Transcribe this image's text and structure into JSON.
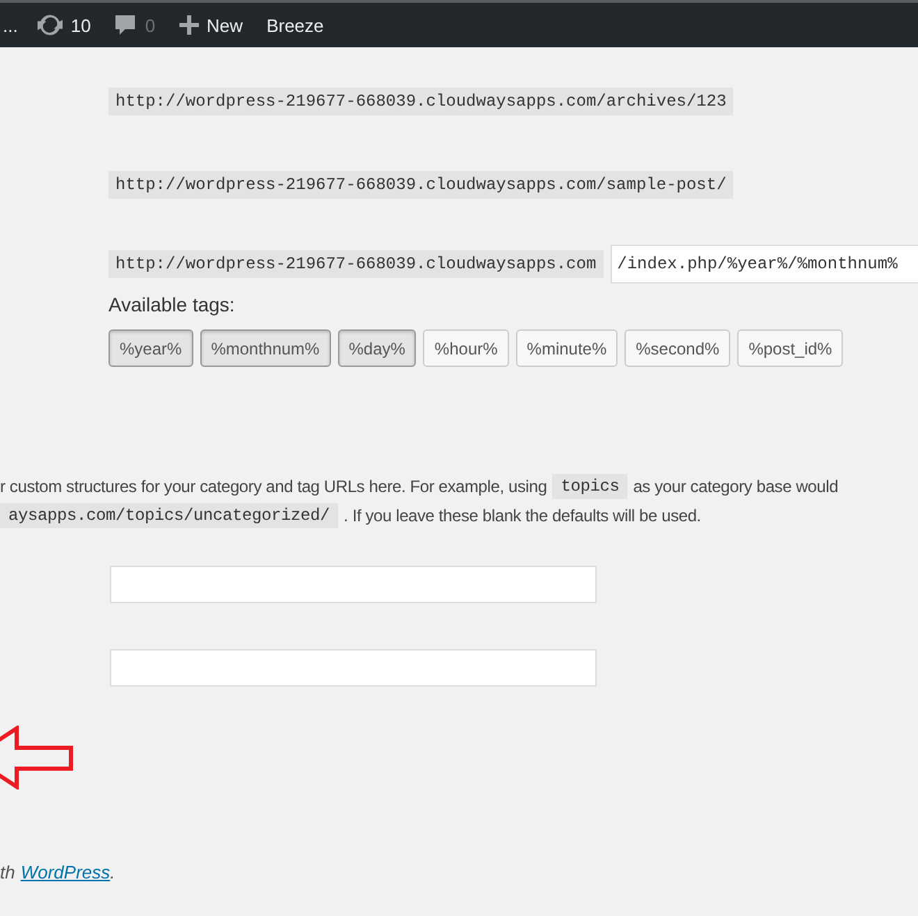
{
  "admin_bar": {
    "items": [
      {
        "kind": "text",
        "label": "..."
      },
      {
        "kind": "updates",
        "label": "10"
      },
      {
        "kind": "comments",
        "label": "0"
      },
      {
        "kind": "new",
        "label": "New"
      },
      {
        "kind": "text",
        "label": "Breeze"
      }
    ]
  },
  "samples": [
    "http://wordpress-219677-668039.cloudwaysapps.com/archives/123",
    "http://wordpress-219677-668039.cloudwaysapps.com/sample-post/"
  ],
  "custom_structure": {
    "prefix": "http://wordpress-219677-668039.cloudwaysapps.com",
    "value": "/index.php/%year%/%monthnum%"
  },
  "available_tags": {
    "label": "Available tags:",
    "tags": [
      {
        "label": "%year%",
        "selected": true
      },
      {
        "label": "%monthnum%",
        "selected": true
      },
      {
        "label": "%day%",
        "selected": true
      },
      {
        "label": "%hour%",
        "selected": false
      },
      {
        "label": "%minute%",
        "selected": false
      },
      {
        "label": "%second%",
        "selected": false
      },
      {
        "label": "%post_id%",
        "selected": false
      }
    ]
  },
  "description": [
    [
      {
        "kind": "text",
        "text": "r custom structures for your category and tag URLs here. For example, using"
      },
      {
        "kind": "code",
        "text": "topics"
      },
      {
        "kind": "text",
        "text": "as your category base would"
      }
    ],
    [
      {
        "kind": "code",
        "text": "aysapps.com/topics/uncategorized/"
      },
      {
        "kind": "text",
        "text": ". If you leave these blank the defaults will be used."
      }
    ]
  ],
  "base_fields": [
    {
      "kind": "text"
    },
    {
      "kind": "text"
    }
  ],
  "footer": {
    "prefix": "th",
    "link": "WordPress",
    "suffix": "."
  }
}
